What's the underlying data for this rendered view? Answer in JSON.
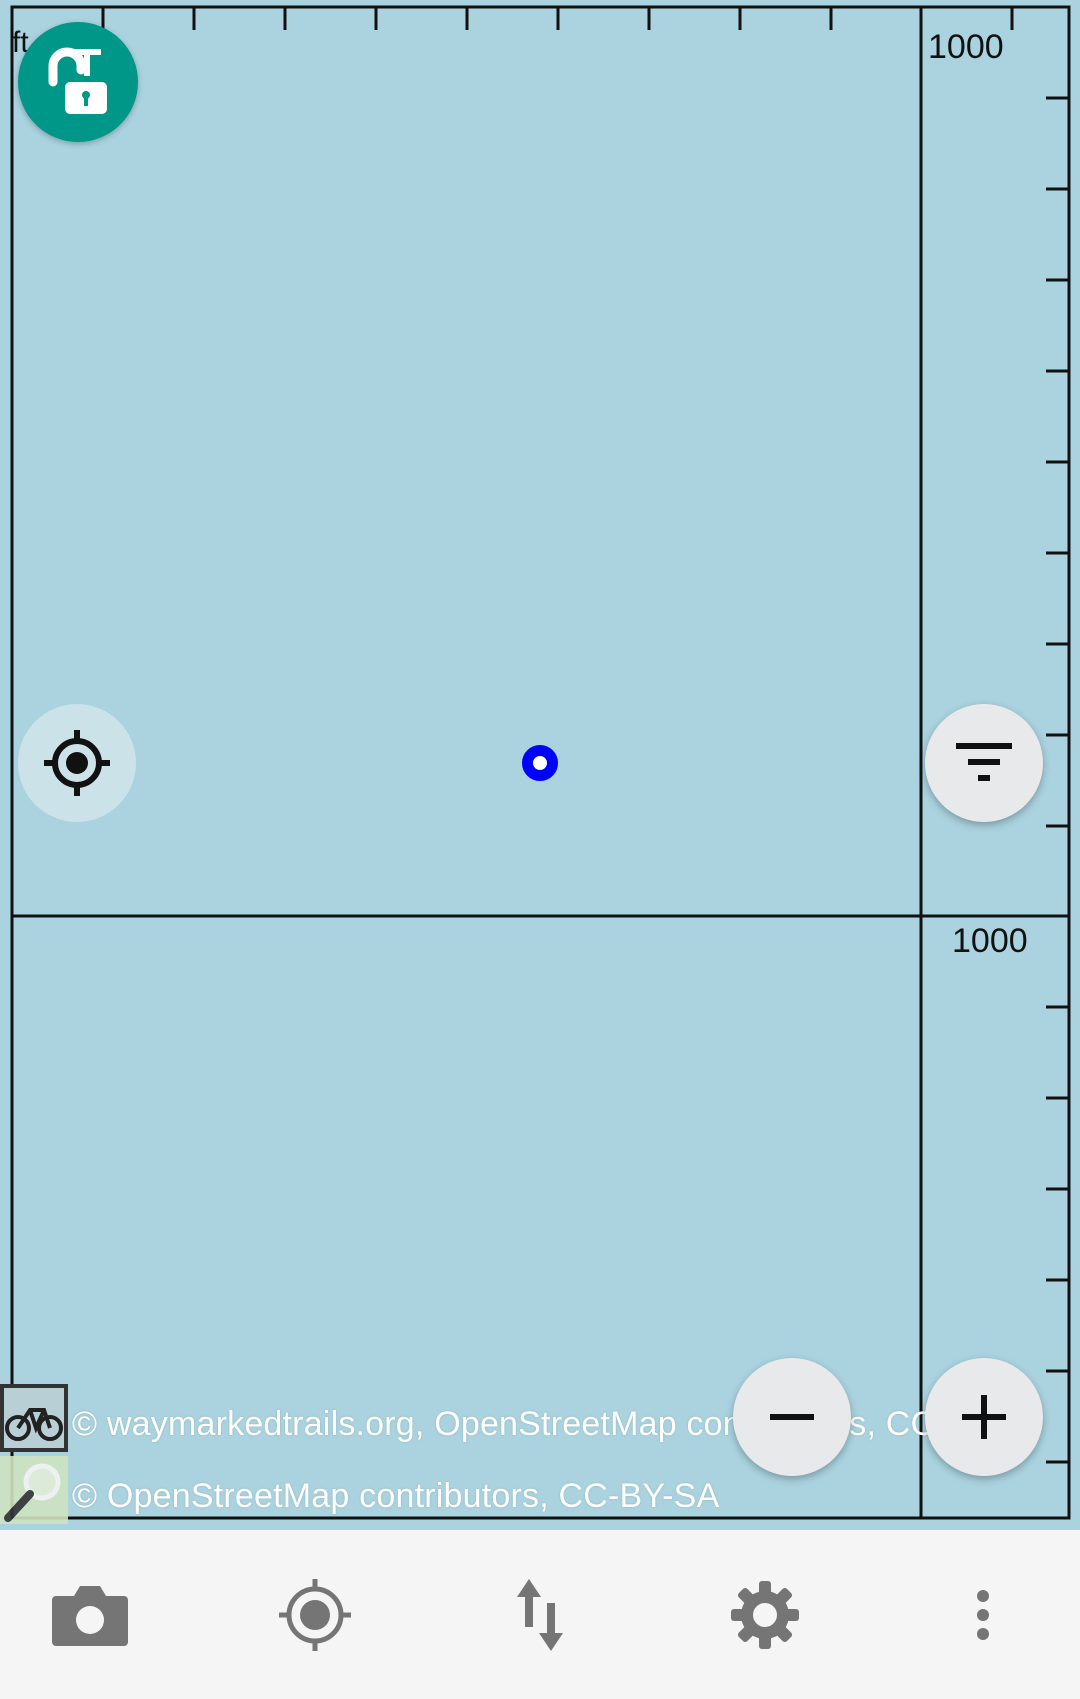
{
  "map": {
    "unit_label": "ft",
    "scale_top": "1000",
    "scale_bottom": "1000",
    "background_color": "#aad3df",
    "attributions": [
      "© waymarkedtrails.org, OpenStreetMap contributors, CC-by-SA",
      "© OpenStreetMap contributors, CC-BY-SA"
    ]
  },
  "controls": {
    "lock_icon": "lock-open-t-icon",
    "locate_icon": "crosshair-icon",
    "filter_icon": "filter-icon",
    "zoom_out_icon": "minus-icon",
    "zoom_in_icon": "plus-icon",
    "accent_color": "#009688"
  },
  "bottom_bar": {
    "items": [
      {
        "icon": "camera-icon"
      },
      {
        "icon": "gps-icon"
      },
      {
        "icon": "transfer-icon"
      },
      {
        "icon": "settings-icon"
      },
      {
        "icon": "more-vert-icon"
      }
    ]
  }
}
